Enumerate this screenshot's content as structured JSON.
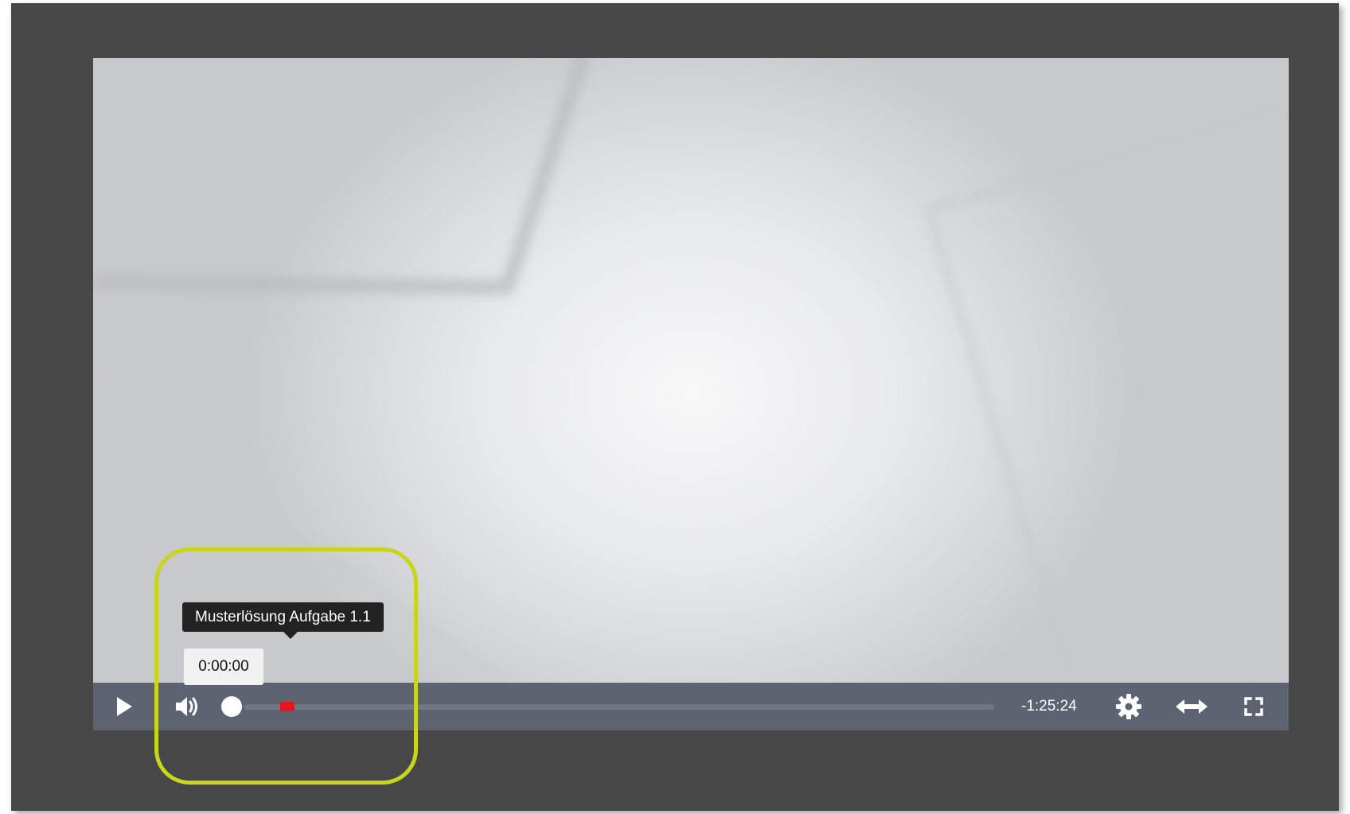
{
  "player": {
    "chapter_tooltip": "Musterlösung Aufgabe 1.1",
    "hover_time": "0:00:00",
    "time_remaining": "-1:25:24",
    "progress_fraction": 0.0,
    "volume_fraction": 0.0
  },
  "icons": {
    "play": "play-icon",
    "volume": "volume-icon",
    "settings": "gear-icon",
    "wide": "double-arrow-icon",
    "fullscreen": "fullscreen-icon"
  },
  "colors": {
    "frame_background": "#474747",
    "control_bar": "#5d6370",
    "progress_track": "#6f7684",
    "chapter_marker": "#e8141b",
    "tooltip_dark": "#222222",
    "tooltip_light": "#f1f1f2",
    "highlight_outline": "#c9d41a"
  }
}
